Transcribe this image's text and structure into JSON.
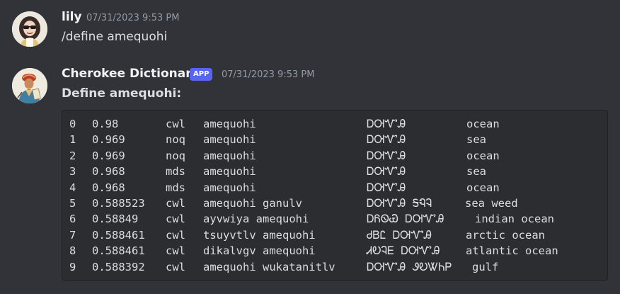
{
  "messages": [
    {
      "author": "lily",
      "timestamp": "07/31/2023 9:53 PM",
      "text": "/define amequohi"
    },
    {
      "author": "Cherokee Dictionary",
      "badge": "APP",
      "timestamp": "07/31/2023 9:53 PM",
      "heading": "Define amequohi:"
    }
  ],
  "results": [
    {
      "idx": "0",
      "score": "0.98",
      "src": "cwl",
      "word": "amequohi",
      "syllabary": "ᎠᎺᏉᎯ",
      "english": "ocean"
    },
    {
      "idx": "1",
      "score": "0.969",
      "src": "noq",
      "word": "amequohi",
      "syllabary": "ᎠᎺᏉᎯ",
      "english": "sea"
    },
    {
      "idx": "2",
      "score": "0.969",
      "src": "noq",
      "word": "amequohi",
      "syllabary": "ᎠᎺᏉᎯ",
      "english": "ocean"
    },
    {
      "idx": "3",
      "score": "0.968",
      "src": "mds",
      "word": "amequohi",
      "syllabary": "ᎠᎺᏉᎯ",
      "english": "sea"
    },
    {
      "idx": "4",
      "score": "0.968",
      "src": "mds",
      "word": "amequohi",
      "syllabary": "ᎠᎺᏉᎯ",
      "english": "ocean"
    },
    {
      "idx": "5",
      "score": "0.588523",
      "src": "cwl",
      "word": "amequohi ganulv",
      "syllabary": "ᎠᎺᏉᎯ ᎦᏄᎸ",
      "english": "sea weed"
    },
    {
      "idx": "6",
      "score": "0.58849",
      "src": "cwl",
      "word": "ayvwiya amequohi",
      "syllabary": "ᎠᏲᏫᏯ ᎠᎺᏉᎯ",
      "english": "indian ocean"
    },
    {
      "idx": "7",
      "score": "0.588461",
      "src": "cwl",
      "word": "tsuyvtlv amequohi",
      "syllabary": "ᏧᏴᏝ ᎠᎺᏉᎯ",
      "english": "arctic ocean"
    },
    {
      "idx": "8",
      "score": "0.588461",
      "src": "cwl",
      "word": "dikalvgv amequohi",
      "syllabary": "ᏗᎧᎸᎬ ᎠᎺᏉᎯ",
      "english": "atlantic ocean"
    },
    {
      "idx": "9",
      "score": "0.588392",
      "src": "cwl",
      "word": "amequohi wukatanitlv",
      "syllabary": "ᎠᎺᏉᎯ ᏭᎧᏔᏂᏢ",
      "english": "gulf"
    }
  ],
  "colors": {
    "background": "#313338",
    "code_background": "#2b2d31",
    "app_badge": "#5865f2",
    "username": "#f2f3f5",
    "timestamp": "#949ba4"
  },
  "icons": {
    "user_avatar": "avatar-cartoon-girl-sunglasses-icon",
    "bot_avatar": "avatar-sequoyah-portrait-icon"
  }
}
